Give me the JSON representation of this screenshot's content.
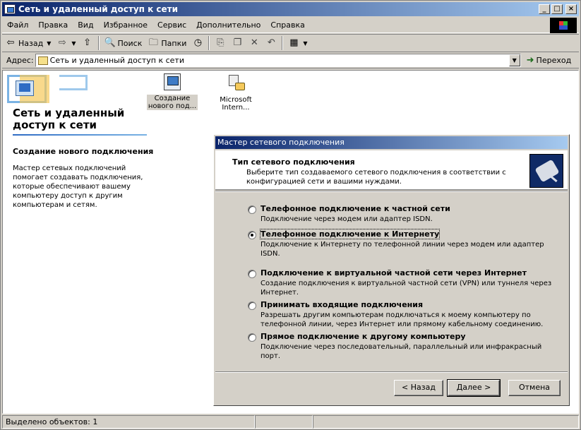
{
  "window": {
    "title": "Сеть и удаленный доступ к сети"
  },
  "menu": [
    "Файл",
    "Правка",
    "Вид",
    "Избранное",
    "Сервис",
    "Дополнительно",
    "Справка"
  ],
  "toolbar": {
    "back": "Назад",
    "search": "Поиск",
    "folders": "Папки"
  },
  "address": {
    "label": "Адрес:",
    "value": "Сеть и удаленный доступ к сети",
    "go": "Переход"
  },
  "sidebar": {
    "title": "Сеть и удаленный доступ к сети",
    "subtitle": "Создание нового подключения",
    "description": "Мастер сетевых подключений помогает создавать подключения, которые обеспечивают вашему компьютеру доступ к другим компьютерам и сетям."
  },
  "items": [
    {
      "label": "Создание нового под..."
    },
    {
      "label": "Microsoft Intern..."
    }
  ],
  "wizard": {
    "title": "Мастер сетевого подключения",
    "header_title": "Тип сетевого подключения",
    "header_desc": "Выберите тип создаваемого сетевого подключения в соответствии с конфигурацией сети и вашими нуждами.",
    "options": [
      {
        "label": "Телефонное подключение к частной сети",
        "desc": "Подключение через модем или адаптер ISDN.",
        "checked": false
      },
      {
        "label": "Телефонное подключение к Интернету",
        "desc": "Подключение к Интернету по телефонной линии через модем или адаптер ISDN.",
        "checked": true
      },
      {
        "label": "Подключение к виртуальной частной сети через Интернет",
        "desc": "Создание подключения к виртуальной частной сети (VPN) или туннеля через Интернет.",
        "checked": false
      },
      {
        "label": "Принимать входящие подключения",
        "desc": "Разрешать другим компьютерам подключаться к моему компьютеру по телефонной линии, через Интернет или прямому кабельному соединению.",
        "checked": false
      },
      {
        "label": "Прямое подключение к другому компьютеру",
        "desc": "Подключение через последовательный, параллельный или инфракрасный порт.",
        "checked": false
      }
    ],
    "back": "< Назад",
    "next": "Далее >",
    "cancel": "Отмена"
  },
  "status": {
    "text": "Выделено объектов: 1"
  },
  "icons": {
    "back": "back-arrow-icon",
    "forward": "forward-arrow-icon",
    "up": "up-folder-icon",
    "search": "search-icon",
    "folders": "folders-icon",
    "history": "history-icon",
    "move": "move-to-icon",
    "copy": "copy-to-icon",
    "delete": "delete-icon",
    "undo": "undo-icon",
    "views": "views-icon",
    "go": "go-arrow-icon"
  }
}
